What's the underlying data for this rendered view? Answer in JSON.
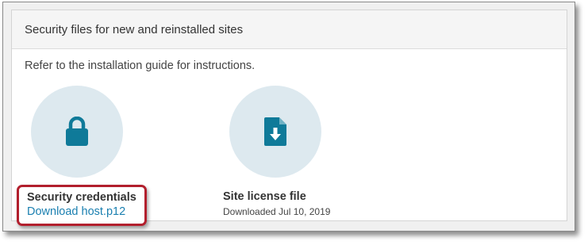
{
  "panel": {
    "title": "Security files for new and reinstalled sites",
    "instructions": "Refer to the installation guide for instructions."
  },
  "items": [
    {
      "icon": "lock-icon",
      "title": "Security credentials",
      "link_text": "Download host.p12"
    },
    {
      "icon": "file-download-icon",
      "title": "Site license file",
      "subtitle": "Downloaded Jul 10, 2019"
    }
  ],
  "colors": {
    "icon": "#0f7a99",
    "icon_circle": "#dde9ef",
    "link": "#1a7fb0",
    "highlight_border": "#b21f2d"
  }
}
